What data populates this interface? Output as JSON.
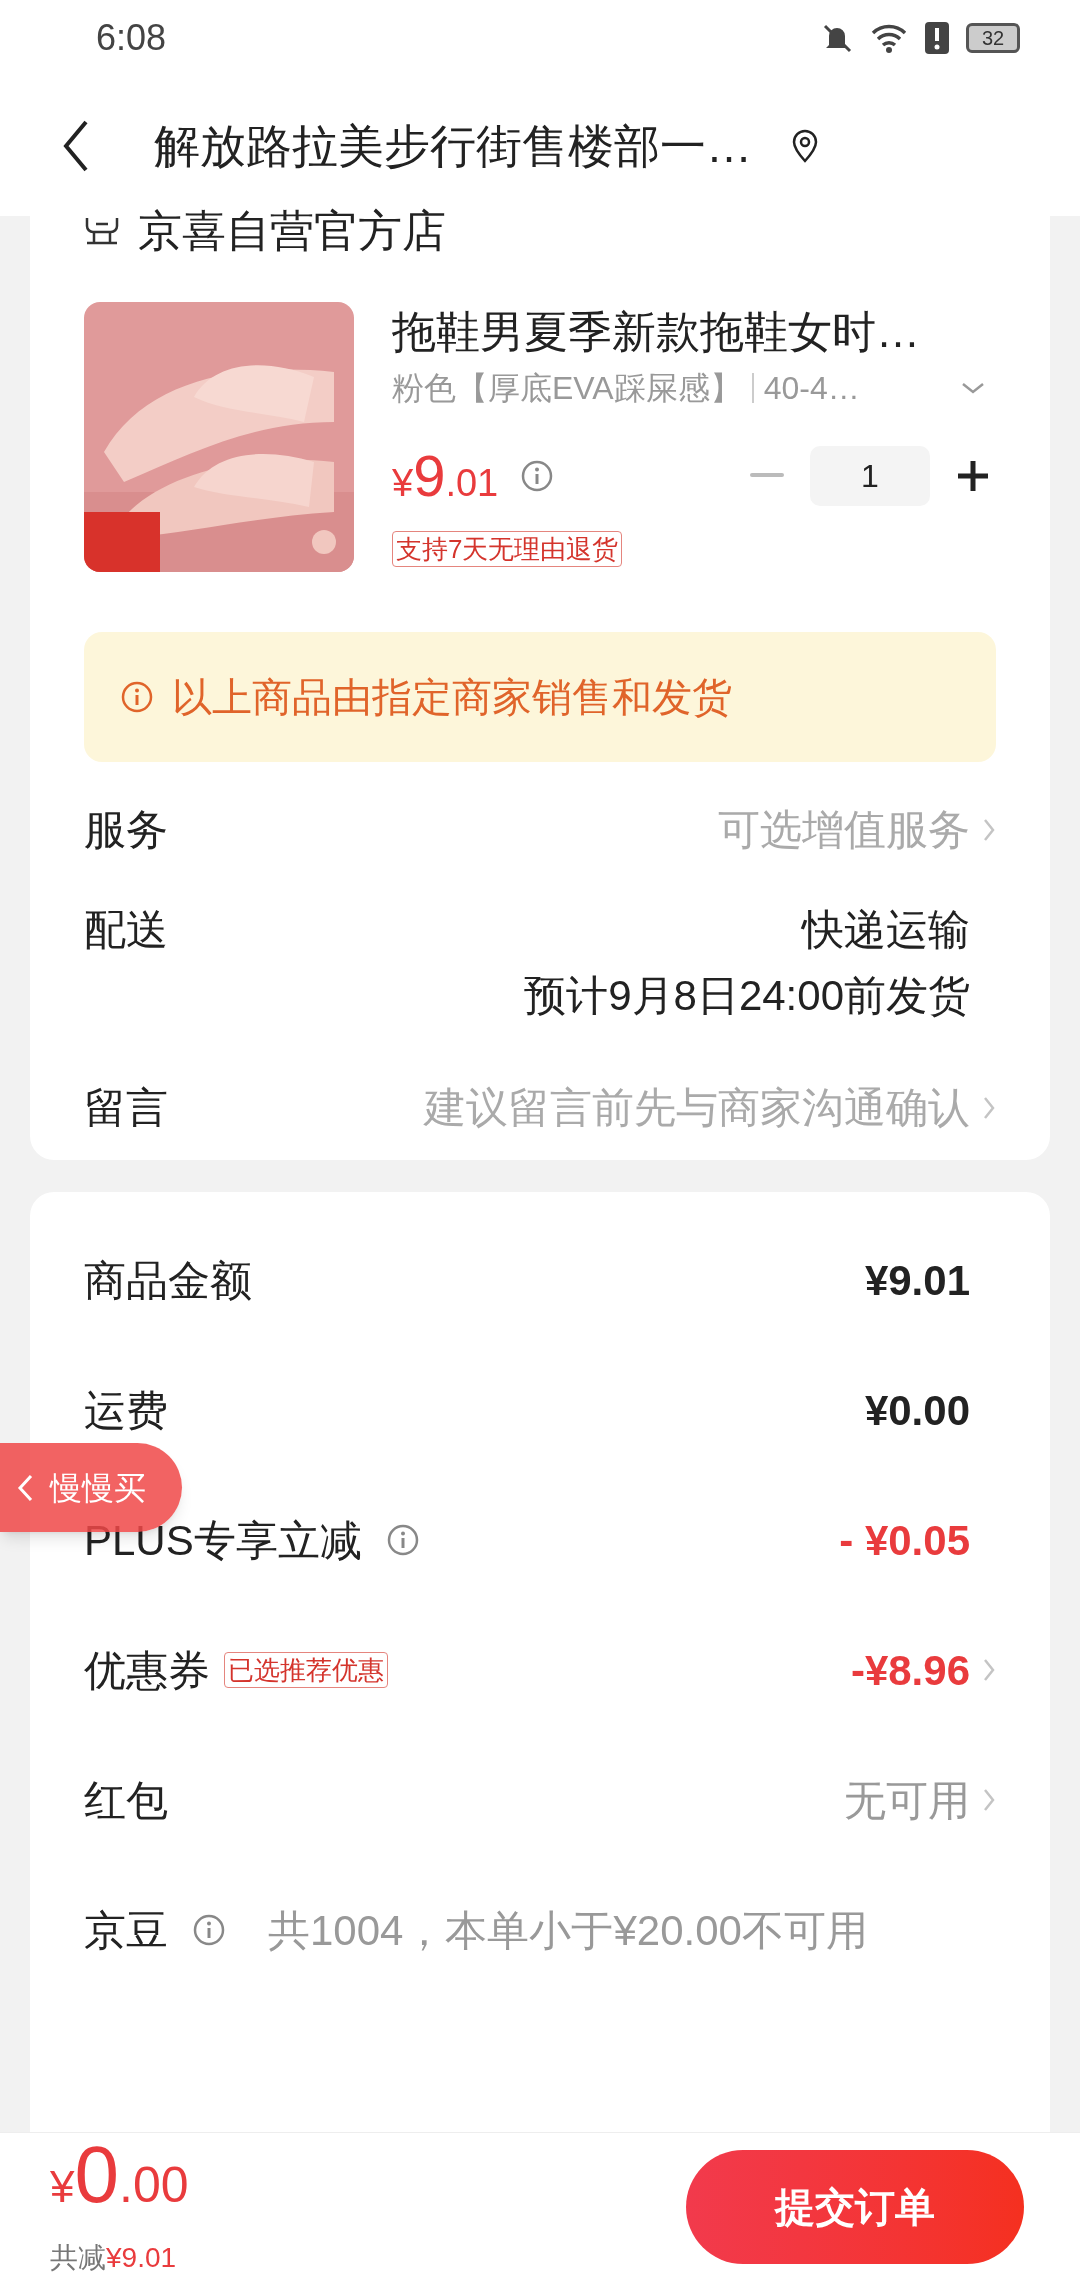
{
  "status_bar": {
    "time": "6:08",
    "battery": "32"
  },
  "nav": {
    "title": "解放路拉美步行街售楼部一…"
  },
  "store": {
    "name": "京喜自营官方店"
  },
  "product": {
    "title": "拖鞋男夏季新款拖鞋女时…",
    "spec": "粉色【厚底EVA踩屎感】",
    "size": "40-4…",
    "price_symbol": "¥",
    "price_int": "9",
    "price_dec": ".01",
    "quantity": "1",
    "tag": "支持7天无理由退货"
  },
  "notice": "以上商品由指定商家销售和发货",
  "order_rows": [
    {
      "label": "服务",
      "value": "可选增值服务",
      "kind": "muted",
      "arrow": true
    },
    {
      "label": "配送",
      "value": "快递运输",
      "extra": "预计9月8日24:00前发货",
      "kind": "normal",
      "arrow": false
    },
    {
      "label": "留言",
      "value": "建议留言前先与商家沟通确认",
      "kind": "muted",
      "arrow": true
    }
  ],
  "price_rows": [
    {
      "label": "商品金额",
      "value": "¥9.01",
      "kind": "normal",
      "info": false,
      "arrow": false
    },
    {
      "label": "运费",
      "value": "¥0.00",
      "kind": "normal",
      "info": false,
      "arrow": false
    },
    {
      "label": "PLUS专享立减",
      "value": "- ¥0.05",
      "kind": "red",
      "info": true,
      "arrow": false
    },
    {
      "label": "优惠券",
      "badge": "已选推荐优惠",
      "value": "-¥8.96",
      "kind": "red",
      "info": false,
      "arrow": true
    },
    {
      "label": "红包",
      "value": "无可用",
      "kind": "muted",
      "info": false,
      "arrow": true
    },
    {
      "label": "京豆",
      "value": "共1004，本单小于¥20.00不可用",
      "kind": "note",
      "info": true,
      "arrow": false
    }
  ],
  "float_tab": {
    "label": "慢慢买"
  },
  "bottom": {
    "symbol": "¥",
    "int": "0",
    "dec": ".00",
    "saved_label": "共减",
    "saved_value": "¥9.01",
    "submit": "提交订单"
  }
}
